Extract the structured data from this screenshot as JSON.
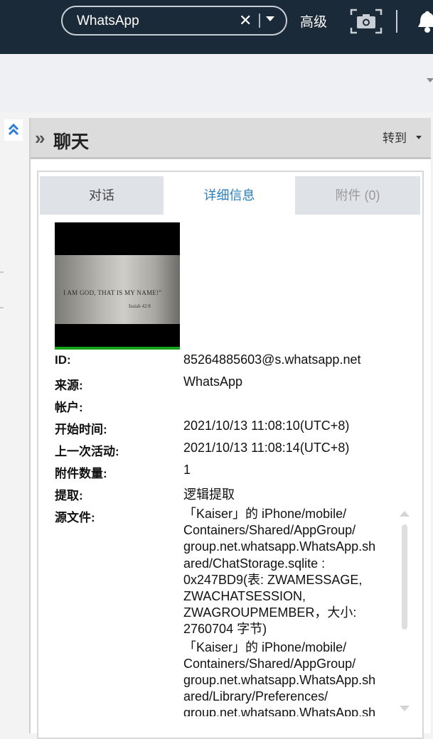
{
  "topbar": {
    "search_value": "WhatsApp",
    "clear_icon": "close-icon",
    "advanced_label": "高级",
    "camera_icon": "camera-icon",
    "bell_icon": "bell-icon"
  },
  "panel": {
    "title": "聊天",
    "goto_label": "转到"
  },
  "tabs": [
    {
      "label": "对话"
    },
    {
      "label": "详细信息",
      "active": true
    },
    {
      "label": "附件 (0)"
    }
  ],
  "thumbnail": {
    "text": "I AM GOD, THAT IS MY NAME!\"",
    "subtext": "Isaiah 42:8"
  },
  "details": {
    "id_label": "ID:",
    "id_value": "85264885603@s.whatsapp.net",
    "source_label": "来源:",
    "source_value": "WhatsApp",
    "account_label": "帐户:",
    "account_value": "",
    "start_label": "开始时间:",
    "start_value": "2021/10/13 11:08:10(UTC+8)",
    "last_label": "上一次活动:",
    "last_value": "2021/10/13 11:08:14(UTC+8)",
    "attach_count_label": "附件数量:",
    "attach_count_value": "1",
    "extract_label": "提取:",
    "extract_value": "逻辑提取",
    "srcfile_label": "源文件:",
    "srcfile_entries": [
      "「Kaiser」的 iPhone/mobile/\nContainers/Shared/AppGroup/\ngroup.net.whatsapp.WhatsApp.sh\nared/ChatStorage.sqlite :\n0x247BD9(表: ZWAMESSAGE,\nZWACHATSESSION,\nZWAGROUPMEMBER，大小:\n2760704 字节)",
      "「Kaiser」的 iPhone/mobile/\nContainers/Shared/AppGroup/\ngroup.net.whatsapp.WhatsApp.sh\nared/Library/Preferences/\ngroup.net.whatsapp.WhatsApp.sh"
    ]
  },
  "colors": {
    "topbar_bg": "#1b2a38",
    "active_tab_text": "#2a7fb8",
    "thumb_bar": "#17a317"
  }
}
